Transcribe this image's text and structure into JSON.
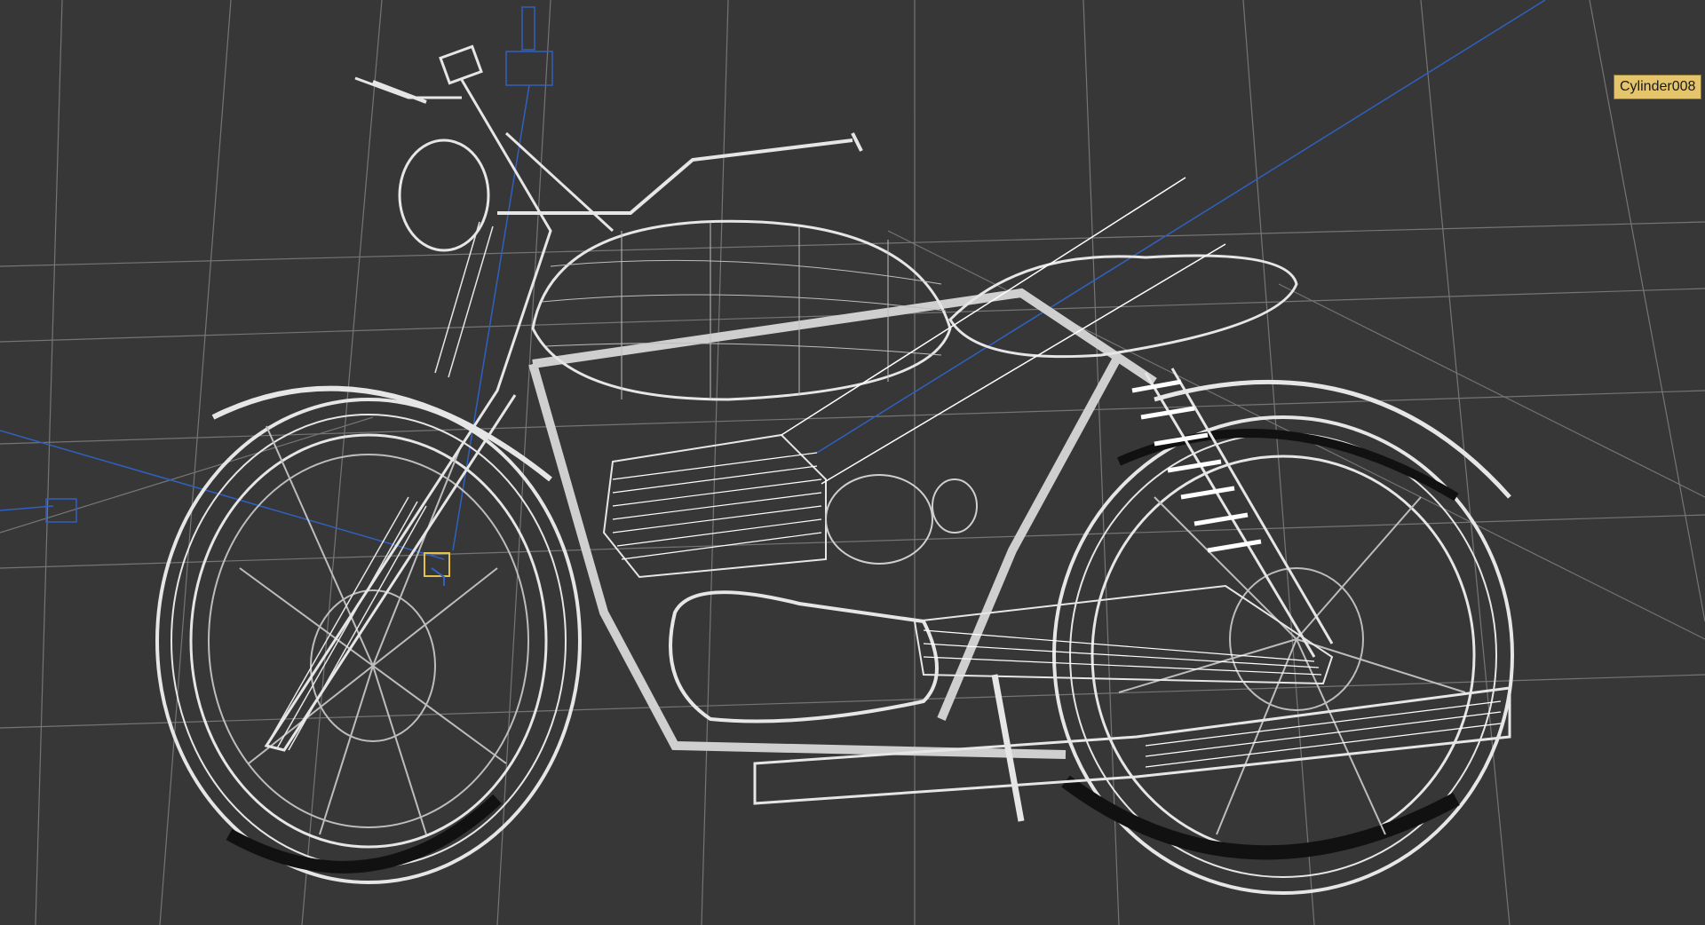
{
  "viewport": {
    "background": "#373737",
    "grid_color": "#8a8a8a",
    "wire_color": "#e6e6e6",
    "selection_color": "#e3c14a",
    "helper_color": "#2f5fb0"
  },
  "tooltip": {
    "object_name": "Cylinder008",
    "background": "#e4c56b"
  },
  "scene": {
    "model": "motorcycle-wireframe"
  }
}
